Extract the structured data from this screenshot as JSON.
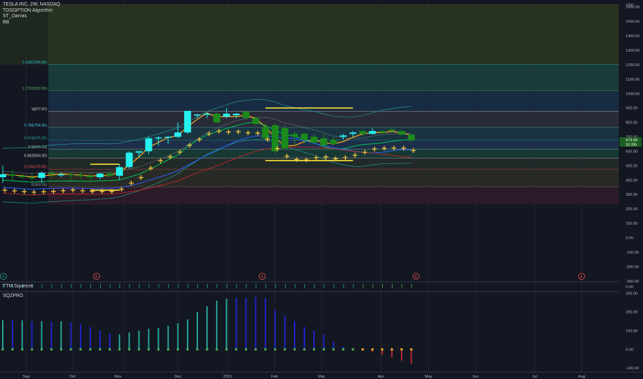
{
  "legend": {
    "symbol": "TESLA INC, 2W, NASDAQ",
    "indicators": [
      "TOSOPTION Algorithm",
      "ST_Darvas",
      "BB"
    ]
  },
  "price_axis": {
    "currency": "USD",
    "ticks": [
      "1600.00",
      "1500.00",
      "1400.00",
      "1300.00",
      "1200.00",
      "1100.00",
      "1000.00",
      "900.00",
      "800.00",
      "700.00",
      "600.00",
      "500.00",
      "400.00",
      "300.00",
      "200.00",
      "100.00",
      "0.00",
      "-100.00",
      "-200.00",
      "-300.00"
    ],
    "last_price_label": "673.60",
    "countdown_label": "2d 20h"
  },
  "fib_labels": [
    "1.618(1200.82)",
    "1.272(1019.56)",
    "1(877.07)",
    "0.786(764.96)",
    "0.618(676.95)",
    "0.5(615.13)",
    "0.382(553.32)",
    "0.236(476.83)",
    "0(353.25)"
  ],
  "time_axis": {
    "ticks": [
      "Sep",
      "Oct",
      "Nov",
      "Dec",
      "2021",
      "Feb",
      "Mar",
      "Apr",
      "May",
      "Jun",
      "Jul",
      "Aug"
    ]
  },
  "event_markers": [
    "S",
    "E",
    "E",
    "E",
    "E"
  ],
  "ttm_panel": {
    "title": "TTM Squeeze",
    "ticks": [
      "0.00"
    ]
  },
  "sqz_panel": {
    "title": "SQZPRO",
    "ticks": [
      "300.00",
      "200.00",
      "100.00",
      "0.00",
      "-100.00"
    ]
  },
  "colors": {
    "background": "#131722",
    "up_candle": "#26f0f0",
    "down_candle": "#1b8a1b",
    "crosses": "#f5c542",
    "darvas": "#ffeb3b",
    "hist_teal": "#26a69a",
    "hist_blue": "#2222cc",
    "hist_red": "#b22833",
    "fib_top": "#3a4a1f"
  },
  "chart_data": {
    "type": "candlestick",
    "title": "TESLA INC, 2W, NASDAQ",
    "ylim": [
      -320,
      1620
    ],
    "candles": [
      {
        "o": 420,
        "h": 500,
        "l": 380,
        "c": 440
      },
      {
        "o": 440,
        "h": 470,
        "l": 400,
        "c": 430
      },
      {
        "o": 430,
        "h": 445,
        "l": 410,
        "c": 420
      },
      {
        "o": 420,
        "h": 450,
        "l": 395,
        "c": 415
      },
      {
        "o": 415,
        "h": 460,
        "l": 380,
        "c": 450
      },
      {
        "o": 450,
        "h": 460,
        "l": 420,
        "c": 440
      },
      {
        "o": 440,
        "h": 455,
        "l": 420,
        "c": 440
      },
      {
        "o": 440,
        "h": 455,
        "l": 405,
        "c": 435
      },
      {
        "o": 435,
        "h": 455,
        "l": 405,
        "c": 430
      },
      {
        "o": 430,
        "h": 450,
        "l": 400,
        "c": 420
      },
      {
        "o": 420,
        "h": 450,
        "l": 405,
        "c": 445
      },
      {
        "o": 445,
        "h": 460,
        "l": 420,
        "c": 430
      },
      {
        "o": 430,
        "h": 510,
        "l": 400,
        "c": 490
      },
      {
        "o": 490,
        "h": 600,
        "l": 480,
        "c": 590
      },
      {
        "o": 590,
        "h": 600,
        "l": 560,
        "c": 600
      },
      {
        "o": 600,
        "h": 700,
        "l": 580,
        "c": 690
      },
      {
        "o": 690,
        "h": 705,
        "l": 640,
        "c": 695
      },
      {
        "o": 695,
        "h": 705,
        "l": 650,
        "c": 700
      },
      {
        "o": 700,
        "h": 800,
        "l": 690,
        "c": 730
      },
      {
        "o": 730,
        "h": 880,
        "l": 720,
        "c": 880
      },
      {
        "o": 850,
        "h": 860,
        "l": 830,
        "c": 855
      },
      {
        "o": 855,
        "h": 870,
        "l": 830,
        "c": 860
      },
      {
        "o": 860,
        "h": 870,
        "l": 800,
        "c": 800
      },
      {
        "o": 840,
        "h": 900,
        "l": 830,
        "c": 860
      },
      {
        "o": 850,
        "h": 865,
        "l": 830,
        "c": 860
      },
      {
        "o": 875,
        "h": 880,
        "l": 820,
        "c": 830
      },
      {
        "o": 830,
        "h": 840,
        "l": 780,
        "c": 790
      },
      {
        "o": 770,
        "h": 790,
        "l": 680,
        "c": 690
      },
      {
        "o": 780,
        "h": 790,
        "l": 580,
        "c": 600
      },
      {
        "o": 760,
        "h": 780,
        "l": 620,
        "c": 620
      },
      {
        "o": 720,
        "h": 740,
        "l": 640,
        "c": 700
      },
      {
        "o": 720,
        "h": 730,
        "l": 650,
        "c": 680
      },
      {
        "o": 700,
        "h": 720,
        "l": 650,
        "c": 660
      },
      {
        "o": 690,
        "h": 720,
        "l": 640,
        "c": 640
      },
      {
        "o": 680,
        "h": 700,
        "l": 650,
        "c": 650
      },
      {
        "o": 700,
        "h": 720,
        "l": 680,
        "c": 710
      },
      {
        "o": 720,
        "h": 740,
        "l": 700,
        "c": 730
      },
      {
        "o": 740,
        "h": 745,
        "l": 705,
        "c": 720
      },
      {
        "o": 720,
        "h": 760,
        "l": 715,
        "c": 740
      },
      {
        "o": 740,
        "h": 745,
        "l": 720,
        "c": 730
      },
      {
        "o": 750,
        "h": 760,
        "l": 730,
        "c": 740
      },
      {
        "o": 740,
        "h": 745,
        "l": 705,
        "c": 715
      },
      {
        "o": 715,
        "h": 720,
        "l": 660,
        "c": 674
      }
    ],
    "squeeze_histogram": [
      155,
      155,
      155,
      150,
      150,
      148,
      150,
      145,
      135,
      120,
      100,
      85,
      80,
      90,
      100,
      110,
      115,
      125,
      140,
      160,
      200,
      230,
      260,
      270,
      275,
      275,
      280,
      275,
      210,
      180,
      150,
      120,
      100,
      80,
      40,
      15,
      2,
      -5,
      -15,
      -30,
      -42,
      -60,
      -75
    ],
    "darvas_boxes": [
      {
        "start": 9,
        "end": 12,
        "top": 510,
        "bottom": 330
      },
      {
        "start": 27,
        "end": 36,
        "top": 900,
        "bottom": 535
      }
    ]
  }
}
